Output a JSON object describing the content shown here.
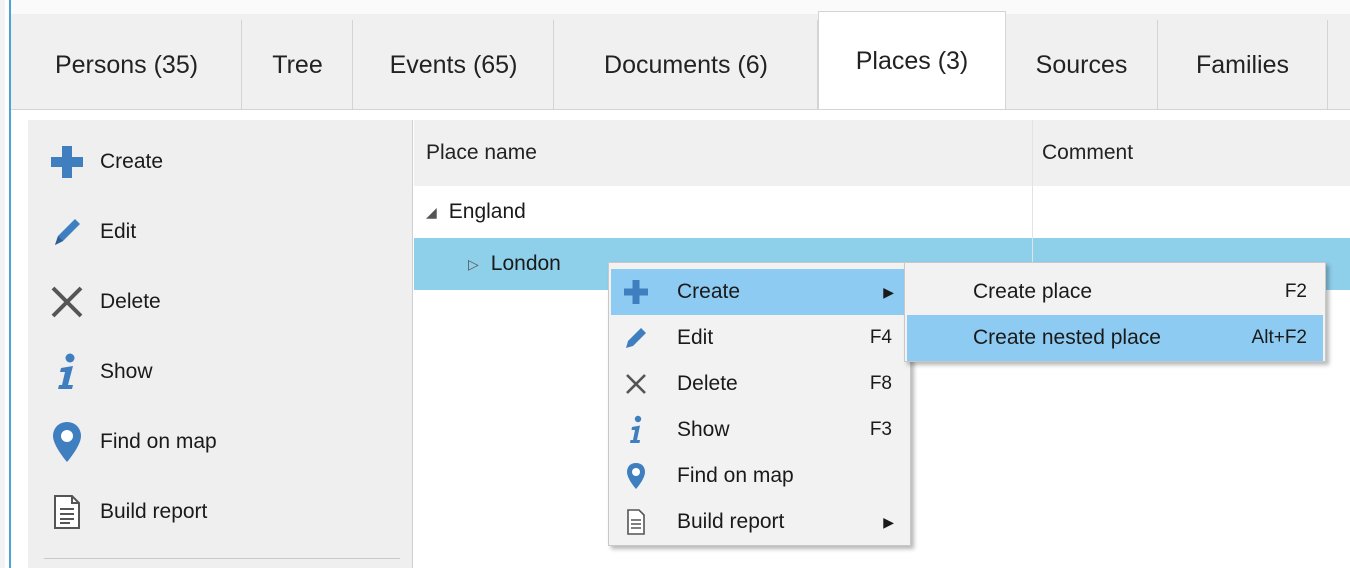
{
  "tabs": [
    {
      "label": "Persons (35)"
    },
    {
      "label": "Tree"
    },
    {
      "label": "Events (65)"
    },
    {
      "label": "Documents (6)"
    },
    {
      "label": "Places (3)"
    },
    {
      "label": "Sources"
    },
    {
      "label": "Families"
    }
  ],
  "active_tab": "Places (3)",
  "sidebar": {
    "items": [
      {
        "label": "Create",
        "icon": "plus-icon"
      },
      {
        "label": "Edit",
        "icon": "pencil-icon"
      },
      {
        "label": "Delete",
        "icon": "cross-icon"
      },
      {
        "label": "Show",
        "icon": "info-icon"
      },
      {
        "label": "Find on map",
        "icon": "map-pin-icon"
      },
      {
        "label": "Build report",
        "icon": "document-icon"
      }
    ]
  },
  "grid": {
    "columns": [
      "Place name",
      "Comment"
    ],
    "rows": [
      {
        "name": "England",
        "comment": "",
        "expanded": true
      },
      {
        "name": "London",
        "comment": "",
        "expanded": false,
        "selected": true
      }
    ]
  },
  "context_menu": {
    "items": [
      {
        "label": "Create",
        "shortcut": "",
        "submenu": true,
        "icon": "plus-icon"
      },
      {
        "label": "Edit",
        "shortcut": "F4",
        "icon": "pencil-icon"
      },
      {
        "label": "Delete",
        "shortcut": "F8",
        "icon": "cross-icon"
      },
      {
        "label": "Show",
        "shortcut": "F3",
        "icon": "info-icon"
      },
      {
        "label": "Find on map",
        "shortcut": "",
        "icon": "map-pin-icon"
      },
      {
        "label": "Build report",
        "shortcut": "",
        "submenu": true,
        "icon": "document-icon"
      }
    ]
  },
  "submenu": {
    "items": [
      {
        "label": "Create place",
        "shortcut": "F2"
      },
      {
        "label": "Create nested place",
        "shortcut": "Alt+F2",
        "highlighted": true
      }
    ]
  },
  "colors": {
    "accent_blue": "#3f7fc0",
    "selection": "#8ecfea",
    "menu_highlight": "#8ecbf2"
  }
}
